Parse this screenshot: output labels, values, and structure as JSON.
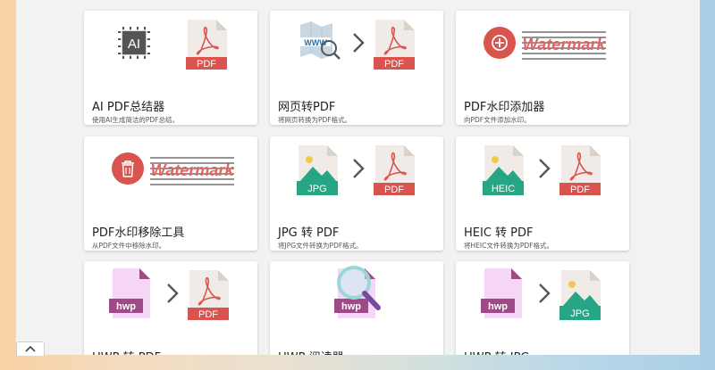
{
  "tools": [
    {
      "title": "AI PDF总结器",
      "desc": "使用AI生成简洁的PDF总结。",
      "icons": {
        "source": "ai-chip-icon",
        "target": "pdf-file-icon"
      },
      "chip_text": "AI",
      "target_label": "PDF"
    },
    {
      "title": "网页转PDF",
      "desc": "将网页转换为PDF格式。",
      "icons": {
        "source": "webpage-search-icon",
        "target": "pdf-file-icon"
      },
      "source_label": "WWW",
      "target_label": "PDF"
    },
    {
      "title": "PDF水印添加器",
      "desc": "向PDF文件添加水印。",
      "icons": {
        "source": "add-circle-icon",
        "target": "watermark-text-icon"
      },
      "watermark_text": "Watermark"
    },
    {
      "title": "PDF水印移除工具",
      "desc": "从PDF文件中移除水印。",
      "icons": {
        "source": "trash-circle-icon",
        "target": "watermark-text-icon"
      },
      "watermark_text": "Watermark"
    },
    {
      "title": "JPG 转 PDF",
      "desc": "将JPG文件转换为PDF格式。",
      "icons": {
        "source": "jpg-file-icon",
        "target": "pdf-file-icon"
      },
      "source_label": "JPG",
      "target_label": "PDF"
    },
    {
      "title": "HEIC 转 PDF",
      "desc": "将HEIC文件转换为PDF格式。",
      "icons": {
        "source": "heic-file-icon",
        "target": "pdf-file-icon"
      },
      "source_label": "HEIC",
      "target_label": "PDF"
    },
    {
      "title": "HWP 转 PDF",
      "icons": {
        "source": "hwp-file-icon",
        "target": "pdf-file-icon"
      },
      "source_label": "hwp",
      "target_label": "PDF"
    },
    {
      "title": "HWP 阅读器",
      "icons": {
        "source": "hwp-file-icon",
        "overlay": "magnifier-icon"
      },
      "source_label": "hwp"
    },
    {
      "title": "HWP 转 JPG",
      "icons": {
        "source": "hwp-file-icon",
        "target": "jpg-file-icon"
      },
      "source_label": "hwp",
      "target_label": "JPG"
    }
  ],
  "colors": {
    "pdf_red": "#d9534f",
    "watermark_red": "#e06666",
    "hwp_purple": "#9e4a86",
    "hwp_file": "#f6d6f6",
    "jpg_green": "#26a685",
    "chip_gray": "#555555"
  },
  "scroll_button_icon": "chevron-up-icon"
}
